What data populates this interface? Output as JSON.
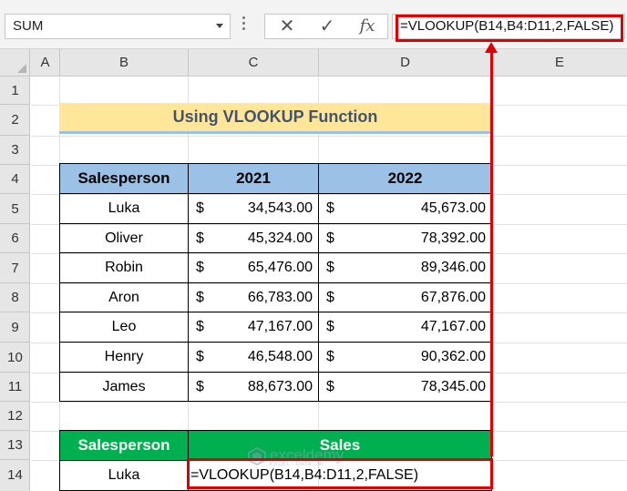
{
  "formula_bar": {
    "name_box": "SUM",
    "cancel_icon": "✕",
    "enter_icon": "✓",
    "fx_label": "fx",
    "formula": "=VLOOKUP(B14,B4:D11,2,FALSE)"
  },
  "columns": [
    "A",
    "B",
    "C",
    "D",
    "E"
  ],
  "rows": [
    "1",
    "2",
    "3",
    "4",
    "5",
    "6",
    "7",
    "8",
    "9",
    "10",
    "11",
    "12",
    "13",
    "14"
  ],
  "sheet": {
    "title": "Using VLOOKUP Function",
    "table_headers": [
      "Salesperson",
      "2021",
      "2022"
    ],
    "currency_symbol": "$",
    "table_rows": [
      {
        "name": "Luka",
        "y2021": "34,543.00",
        "y2022": "45,673.00"
      },
      {
        "name": "Oliver",
        "y2021": "45,324.00",
        "y2022": "78,392.00"
      },
      {
        "name": "Robin",
        "y2021": "65,476.00",
        "y2022": "89,346.00"
      },
      {
        "name": "Aron",
        "y2021": "66,783.00",
        "y2022": "67,876.00"
      },
      {
        "name": "Leo",
        "y2021": "47,167.00",
        "y2022": "47,167.00"
      },
      {
        "name": "Henry",
        "y2021": "46,548.00",
        "y2022": "90,362.00"
      },
      {
        "name": "James",
        "y2021": "88,673.00",
        "y2022": "78,345.00"
      }
    ],
    "lookup_headers": [
      "Salesperson",
      "Sales"
    ],
    "lookup_name": "Luka",
    "lookup_formula": "=VLOOKUP(B14,B4:D11,2,FALSE)"
  },
  "watermark": {
    "name": "exceldemy",
    "tagline": "EXCEL · DATA · BI"
  },
  "colors": {
    "title_fill": "#ffe699",
    "header_blue": "#9bc2e6",
    "header_green": "#00b050",
    "annotation_red": "#e00000"
  }
}
